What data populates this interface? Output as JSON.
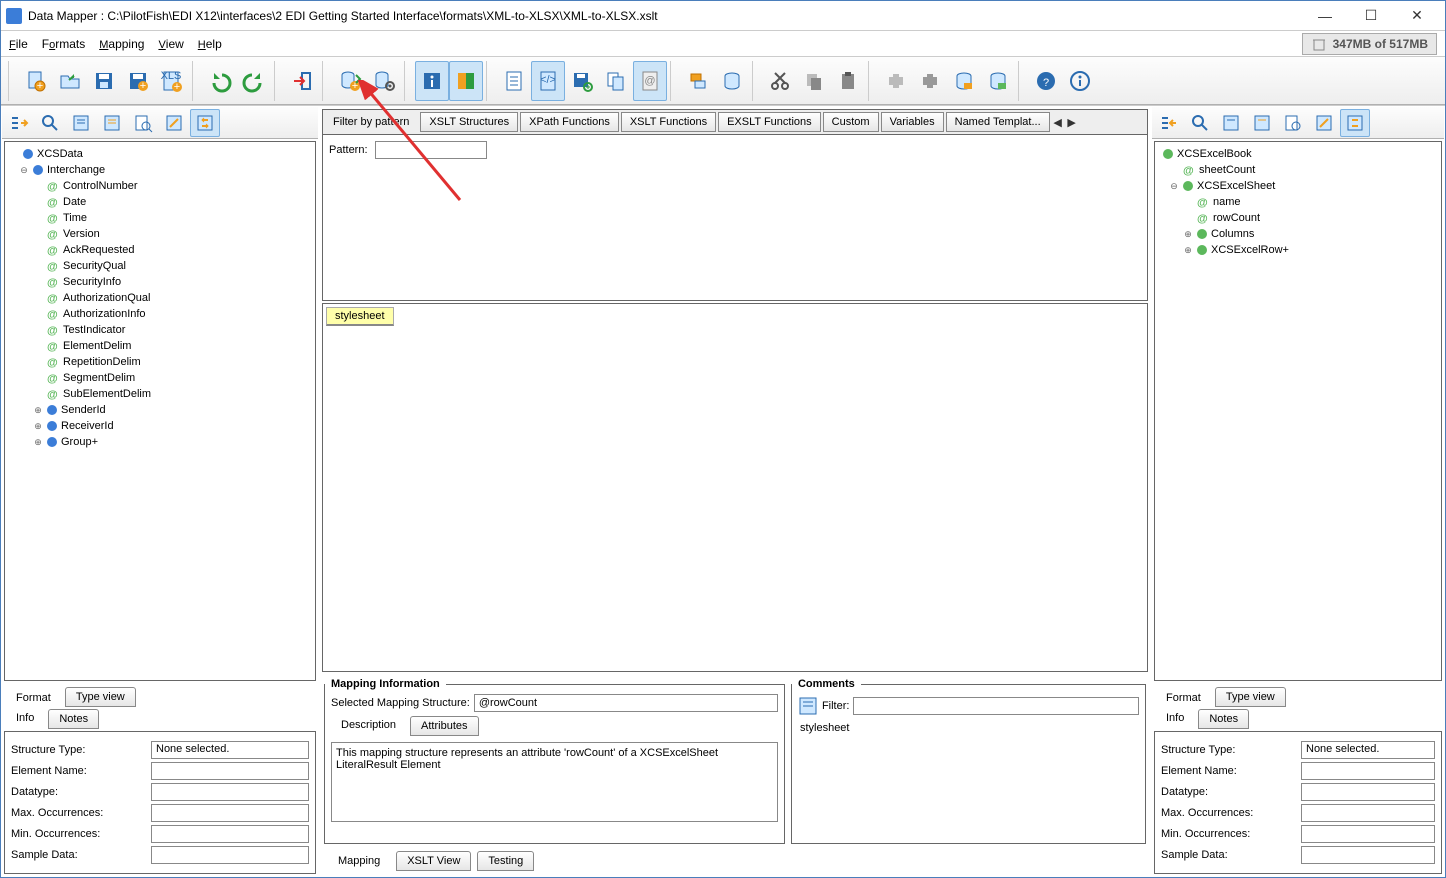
{
  "title": "Data Mapper : C:\\PilotFish\\EDI X12\\interfaces\\2 EDI Getting Started Interface\\formats\\XML-to-XLSX\\XML-to-XLSX.xslt",
  "memory": "347MB of 517MB",
  "menu": {
    "file": "File",
    "formats": "Formats",
    "mapping": "Mapping",
    "view": "View",
    "help": "Help"
  },
  "centerTabs": {
    "filter": "Filter by pattern",
    "xsltStruct": "XSLT Structures",
    "xpathFn": "XPath Functions",
    "xsltFn": "XSLT Functions",
    "exsltFn": "EXSLT Functions",
    "custom": "Custom",
    "variables": "Variables",
    "namedTmpl": "Named Templat..."
  },
  "patternLabel": "Pattern:",
  "stylesheetChip": "stylesheet",
  "leftTree": {
    "root": "XCSData",
    "interchange": "Interchange",
    "attrs": [
      "ControlNumber",
      "Date",
      "Time",
      "Version",
      "AckRequested",
      "SecurityQual",
      "SecurityInfo",
      "AuthorizationQual",
      "AuthorizationInfo",
      "TestIndicator",
      "ElementDelim",
      "RepetitionDelim",
      "SegmentDelim",
      "SubElementDelim"
    ],
    "children": [
      "SenderId",
      "ReceiverId",
      "Group+"
    ]
  },
  "rightTree": {
    "root": "XCSExcelBook",
    "sheetCount": "sheetCount",
    "sheet": "XCSExcelSheet",
    "name": "name",
    "rowCount": "rowCount",
    "columns": "Columns",
    "row": "XCSExcelRow+"
  },
  "bottomTabs": {
    "format": "Format",
    "typeView": "Type view"
  },
  "infoTabs": {
    "info": "Info",
    "notes": "Notes"
  },
  "infoFields": {
    "structureType": "Structure Type:",
    "structureTypeVal": "None selected.",
    "elementName": "Element Name:",
    "datatype": "Datatype:",
    "maxOcc": "Max. Occurrences:",
    "minOcc": "Min. Occurrences:",
    "sampleData": "Sample Data:"
  },
  "mapInfo": {
    "legend": "Mapping Information",
    "selStructLabel": "Selected Mapping Structure:",
    "selStructVal": "@rowCount",
    "descTab": "Description",
    "attrTab": "Attributes",
    "descText": "This mapping structure represents an attribute 'rowCount' of a XCSExcelSheet LiteralResult Element"
  },
  "comments": {
    "legend": "Comments",
    "filterLabel": "Filter:",
    "item": "stylesheet"
  },
  "mainBottomTabs": {
    "mapping": "Mapping",
    "xsltView": "XSLT View",
    "testing": "Testing"
  }
}
